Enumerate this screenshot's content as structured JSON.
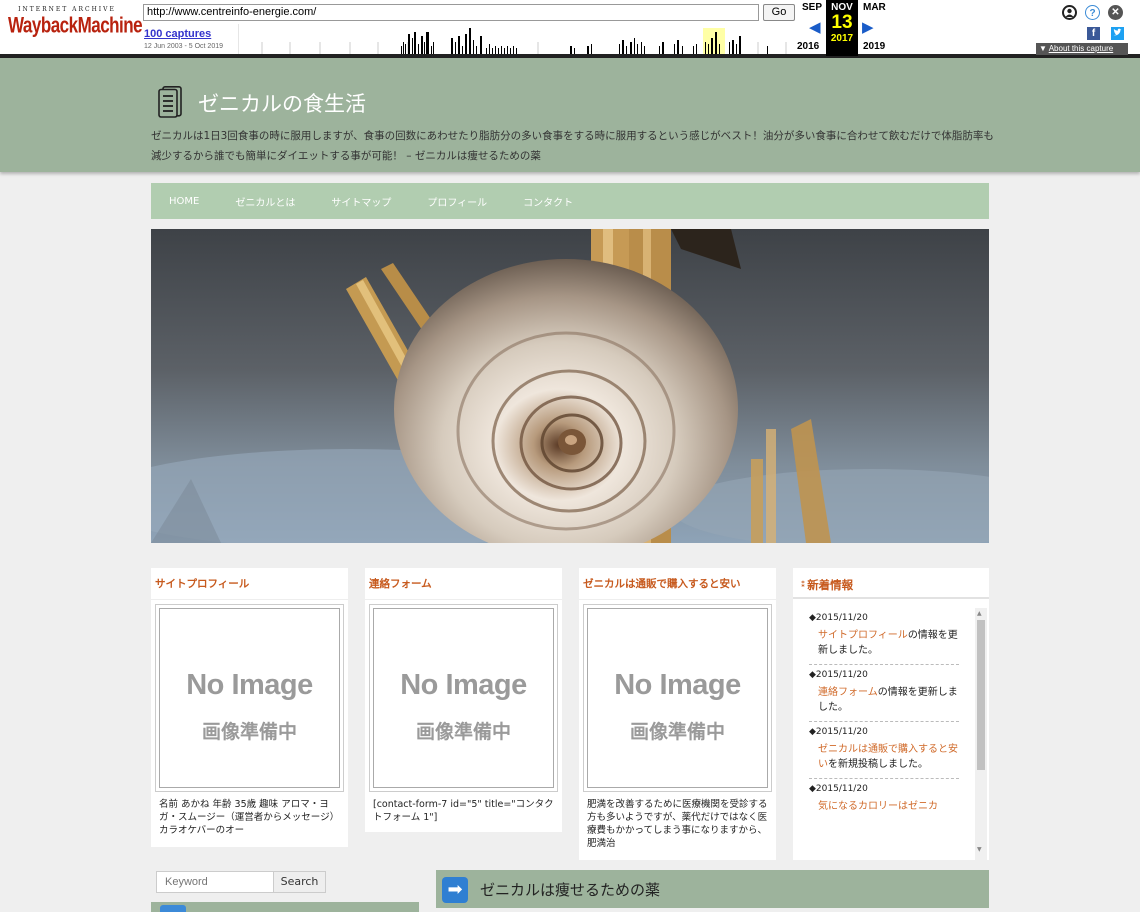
{
  "wayback": {
    "logo_top": "INTERNET ARCHIVE",
    "logo_main": "WaybackMachine",
    "url": "http://www.centreinfo-energie.com/",
    "go_label": "Go",
    "captures_label": "100 captures",
    "range_label": "12 Jun 2003 - 5 Oct 2019",
    "prev_month": "SEP",
    "cur_month": "NOV",
    "next_month": "MAR",
    "cur_day": "13",
    "prev_year": "2016",
    "cur_year": "2017",
    "next_year": "2019",
    "about_label": "About this capture",
    "facebook_label": "f"
  },
  "site": {
    "title": "ゼニカルの食生活",
    "description": "ゼニカルは1日3回食事の時に服用しますが、食事の回数にあわせたり脂肪分の多い食事をする時に服用するという感じがベスト！油分が多い食事に合わせて飲むだけで体脂肪率も減少するから誰でも簡単にダイエットする事が可能！ – ゼニカルは痩せるための薬"
  },
  "nav": {
    "items": [
      "HOME",
      "ゼニカルとは",
      "サイトマップ",
      "プロフィール",
      "コンタクト"
    ]
  },
  "cards": [
    {
      "title": "サイトプロフィール",
      "noimage": "No Image",
      "noimage_sub": "画像準備中",
      "excerpt": "名前 あかね 年齢 35歳 趣味 アロマ・ヨガ・スムージー（運営者からメッセージ）カラオケバーのオー"
    },
    {
      "title": "連絡フォーム",
      "noimage": "No Image",
      "noimage_sub": "画像準備中",
      "excerpt": "[contact-form-7 id=\"5\" title=\"コンタクトフォーム 1\"]"
    },
    {
      "title": "ゼニカルは通販で購入すると安い",
      "noimage": "No Image",
      "noimage_sub": "画像準備中",
      "excerpt": "肥満を改善するために医療機関を受診する方も多いようですが、薬代だけではなく医療費もかかってしまう事になりますから、肥満治"
    }
  ],
  "news": {
    "title": "新着情報",
    "items": [
      {
        "date": "◆2015/11/20",
        "link": "サイトプロフィール",
        "suffix": "の情報を更新しました。"
      },
      {
        "date": "◆2015/11/20",
        "link": "連絡フォーム",
        "suffix": "の情報を更新しました。"
      },
      {
        "date": "◆2015/11/20",
        "link": "ゼニカルは通販で購入すると安い",
        "suffix": "を新規投稿しました。"
      },
      {
        "date": "◆2015/11/20",
        "link": "気になるカロリーはゼニカ",
        "suffix": ""
      }
    ]
  },
  "search": {
    "placeholder": "Keyword",
    "button_label": "Search"
  },
  "main": {
    "heading": "ゼニカルは痩せるための薬"
  },
  "colors": {
    "header_bg": "#9db39c",
    "nav_bg": "#b1cdb0",
    "accent_orange": "#c75a1e",
    "wayback_red": "#b8220e"
  }
}
